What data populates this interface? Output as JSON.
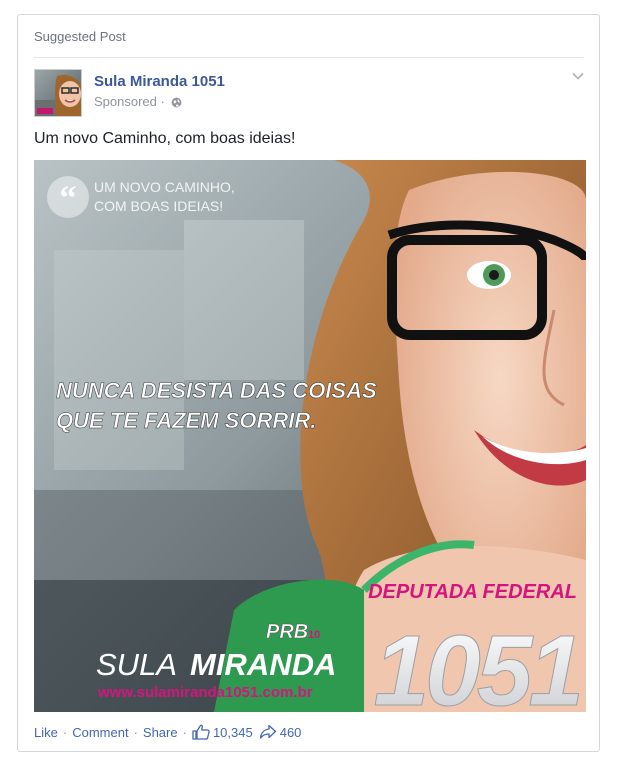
{
  "post": {
    "header_label": "Suggested Post",
    "page_name": "Sula Miranda 1051",
    "sponsored_label": "Sponsored",
    "body_text": "Um novo Caminho, com boas ideias!"
  },
  "image": {
    "quote_line1": "UM NOVO CAMINHO,",
    "quote_line2": "COM BOAS IDEIAS!",
    "slogan_line1": "NUNCA DESISTA DAS COISAS",
    "slogan_line2": "QUE TE FAZEM SORRIR.",
    "role": "DEPUTADA FEDERAL",
    "party": "PRB",
    "party_number": "10",
    "candidate_first": "SULA",
    "candidate_last": "MIRANDA",
    "website": "www.sulamiranda1051.com.br",
    "number": "1051"
  },
  "footer": {
    "like_label": "Like",
    "comment_label": "Comment",
    "share_label": "Share",
    "like_count": "10,345",
    "share_count": "460"
  },
  "colors": {
    "link": "#4267b2",
    "page_name": "#3b5998",
    "magenta": "#d4157f"
  }
}
